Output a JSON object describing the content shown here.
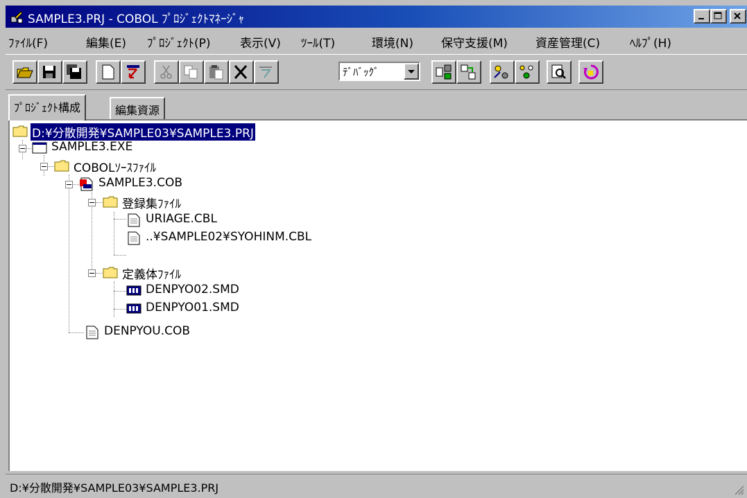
{
  "window": {
    "title": "SAMPLE3.PRJ - COBOL ﾌﾟﾛｼﾞｪｸﾄﾏﾈｰｼﾞｬ"
  },
  "menu": [
    {
      "label": "ﾌｧｲﾙ(F)"
    },
    {
      "label": "編集(E)"
    },
    {
      "label": "ﾌﾟﾛｼﾞｪｸﾄ(P)"
    },
    {
      "label": "表示(V)"
    },
    {
      "label": "ﾂｰﾙ(T)"
    },
    {
      "label": "環境(N)"
    },
    {
      "label": "保守支援(M)"
    },
    {
      "label": "資産管理(C)"
    },
    {
      "label": "ﾍﾙﾌﾟ(H)"
    }
  ],
  "toolbar": {
    "mode_select": "ﾃﾞﾊﾞｯｸﾞ",
    "buttons": [
      "open-icon",
      "save-icon",
      "save-all-icon",
      "new-icon",
      "add-file-icon",
      "cut-icon",
      "copy-icon",
      "paste-icon",
      "delete-icon",
      "dependency-icon",
      "compile-icon",
      "build-icon",
      "rebuild-icon",
      "link-icon",
      "find-icon",
      "run-icon"
    ]
  },
  "tabs": [
    {
      "label": "ﾌﾟﾛｼﾞｪｸﾄ構成",
      "active": true
    },
    {
      "label": "編集資源",
      "active": false
    }
  ],
  "tree": {
    "root": "D:¥分散開発¥SAMPLE03¥SAMPLE3.PRJ",
    "exe": "SAMPLE3.EXE",
    "cobol_folder": "COBOLｿｰｽﾌｧｲﾙ",
    "cob_main": "SAMPLE3.COB",
    "copy_folder": "登録集ﾌｧｲﾙ",
    "copy_1": "URIAGE.CBL",
    "copy_2": "..¥SAMPLE02¥SYOHINM.CBL",
    "def_folder": "定義体ﾌｧｲﾙ",
    "def_1": "DENPYO02.SMD",
    "def_2": "DENPYO01.SMD",
    "cob_sub": "DENPYOU.COB"
  },
  "status": {
    "text": "D:¥分散開発¥SAMPLE03¥SAMPLE3.PRJ"
  },
  "colors": {
    "title_start": "#00007f",
    "title_end": "#6fa3e6",
    "face": "#c0c0c0",
    "selection": "#00007f"
  }
}
